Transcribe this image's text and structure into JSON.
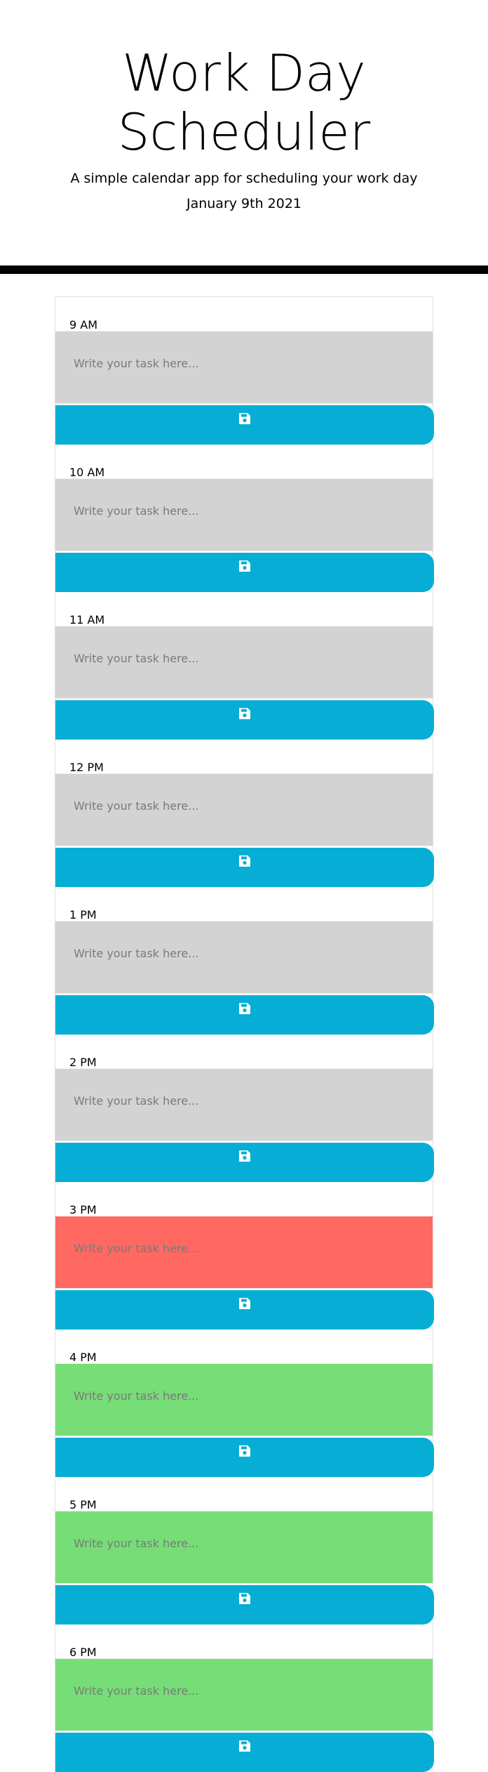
{
  "header": {
    "title": "Work Day Scheduler",
    "lead": "A simple calendar app for scheduling your work day",
    "date": "January 9th 2021"
  },
  "colors": {
    "past": "#d3d3d3",
    "present": "#ff6961",
    "future": "#77dd77",
    "save_button": "#06aed5"
  },
  "time_blocks": [
    {
      "hour": "9 AM",
      "state": "past",
      "placeholder": "Write your task here...",
      "save_icon": "save-icon"
    },
    {
      "hour": "10 AM",
      "state": "past",
      "placeholder": "Write your task here...",
      "save_icon": "save-icon"
    },
    {
      "hour": "11 AM",
      "state": "past",
      "placeholder": "Write your task here...",
      "save_icon": "save-icon"
    },
    {
      "hour": "12 PM",
      "state": "past",
      "placeholder": "Write your task here...",
      "save_icon": "save-icon"
    },
    {
      "hour": "1 PM",
      "state": "past",
      "placeholder": "Write your task here...",
      "save_icon": "save-icon"
    },
    {
      "hour": "2 PM",
      "state": "past",
      "placeholder": "Write your task here...",
      "save_icon": "save-icon"
    },
    {
      "hour": "3 PM",
      "state": "present",
      "placeholder": "Write your task here...",
      "save_icon": "save-icon"
    },
    {
      "hour": "4 PM",
      "state": "future",
      "placeholder": "Write your task here...",
      "save_icon": "save-icon"
    },
    {
      "hour": "5 PM",
      "state": "future",
      "placeholder": "Write your task here...",
      "save_icon": "save-icon"
    },
    {
      "hour": "6 PM",
      "state": "future",
      "placeholder": "Write your task here...",
      "save_icon": "save-icon"
    }
  ]
}
